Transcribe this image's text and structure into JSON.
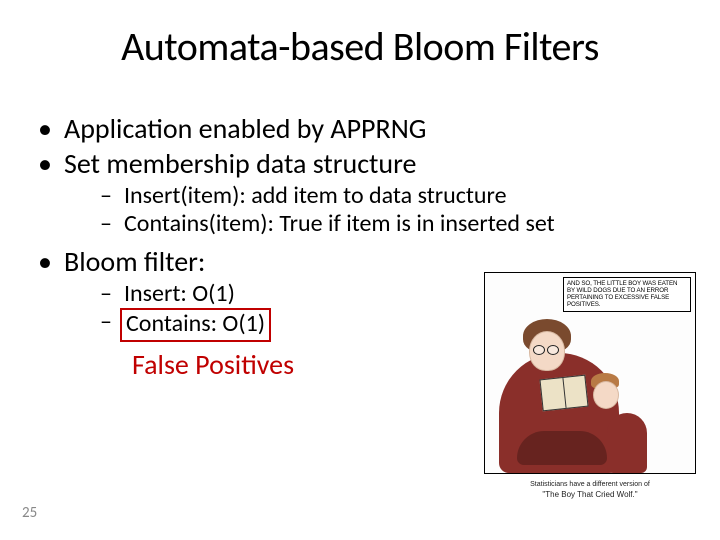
{
  "title": "Automata-based Bloom Filters",
  "bullets": {
    "b1": "Application enabled by APPRNG",
    "b2": "Set membership data structure",
    "b2a": "Insert(item): add item to data structure",
    "b2b": "Contains(item):  True if item is in inserted set",
    "b3": "Bloom filter:",
    "b3a": "Insert: O(1)",
    "b3b": "Contains: O(1)"
  },
  "callout": "False Positives",
  "page_number": "25",
  "comic": {
    "speech": "AND SO, THE LITTLE BOY WAS EATEN BY WILD DOGS DUE TO AN ERROR PERTAINING TO EXCESSIVE FALSE POSITIVES.",
    "caption_line1": "Statisticians have a different version of",
    "caption_line2": "\"The Boy That Cried Wolf.\""
  }
}
